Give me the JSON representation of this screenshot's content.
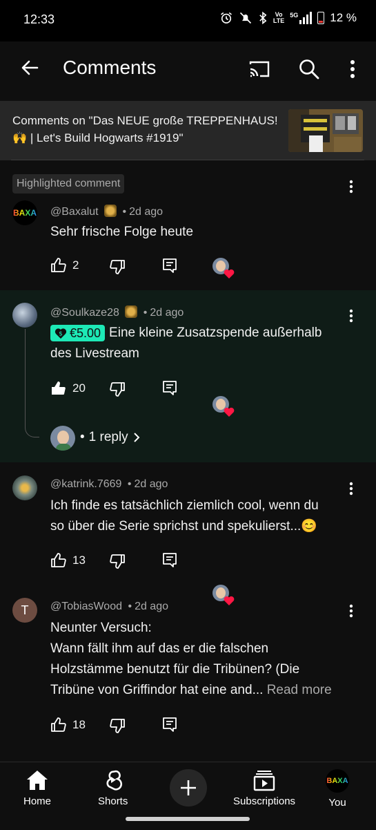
{
  "status_bar": {
    "time": "12:33",
    "battery": "12 %",
    "lte_top": "Vo",
    "lte_bottom": "LTE",
    "network": "5G"
  },
  "header": {
    "title": "Comments"
  },
  "video": {
    "context": "Comments on \"Das NEUE große TREPPENHAUS! 🙌 | Let's Build Hogwarts #1919\""
  },
  "highlight_label": "Highlighted comment",
  "comments": [
    {
      "author": "@Baxalut",
      "time": "2d ago",
      "text": "Sehr frische Folge heute",
      "likes": "2",
      "avatar_text": "BAXA"
    },
    {
      "author": "@Soulkaze28",
      "time": "2d ago",
      "donation": "€5.00",
      "text_line1": "Eine kleine Zusatzspende außerhalb",
      "text_line2": "des Livestream",
      "likes": "20",
      "replies": "1 reply"
    },
    {
      "author": "@katrink.7669",
      "time": "2d ago",
      "text_line1": "Ich finde es tatsächlich ziemlich cool, wenn du",
      "text_line2": "so über die Serie sprichst und spekulierst...😊",
      "likes": "13"
    },
    {
      "author": "@TobiasWood",
      "time": "2d ago",
      "avatar_letter": "T",
      "text_line1": "Neunter Versuch:",
      "text_line2": "Wann fällt ihm auf das er die falschen",
      "text_line3": "Holzstämme benutzt für die Tribünen? (Die",
      "text_line4": "Tribüne von Griffindor hat eine and...",
      "read_more": "Read more",
      "likes": "18"
    }
  ],
  "separator": "•",
  "bottom_nav": {
    "home": "Home",
    "shorts": "Shorts",
    "subscriptions": "Subscriptions",
    "you": "You",
    "you_avatar_text": "BAXA"
  },
  "colors": {
    "background": "#0f0f0f",
    "highlight_bg": "#0f1c17",
    "donation": "#1de9b6",
    "heart": "#ff1744"
  }
}
